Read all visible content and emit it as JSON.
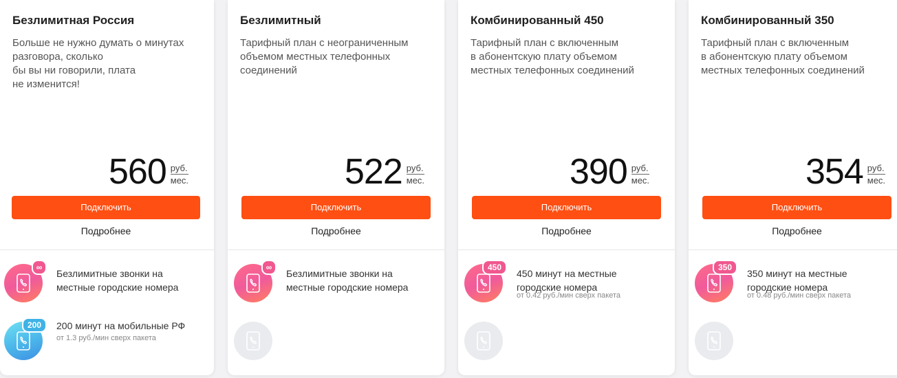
{
  "colors": {
    "accent": "#ff4f12",
    "pink_icon": "#f05a9b",
    "blue_icon": "#4bb6ea",
    "grey_icon": "#e9ebee"
  },
  "cards": [
    {
      "title": "Безлимитная Россия",
      "description": "Больше не нужно думать о минутах\nразговора, сколько\nбы вы ни говорили, плата\nне изменится!",
      "price": "560",
      "unit_top": "руб.",
      "unit_bottom": "мес.",
      "button": "Подключить",
      "more": "Подробнее",
      "features": [
        {
          "icon": "phone-icon",
          "badge": "∞",
          "text": "Безлимитные звонки на\nместные городские номера",
          "sub": ""
        },
        {
          "icon": "phone-icon",
          "badge": "200",
          "text": "200 минут на мобильные РФ",
          "sub": "от 1.3 руб./мин сверх пакета"
        }
      ]
    },
    {
      "title": "Безлимитный",
      "description": "Тарифный план с неограниченным\nобъемом местных телефонных\nсоединений",
      "price": "522",
      "unit_top": "руб.",
      "unit_bottom": "мес.",
      "button": "Подключить",
      "more": "Подробнее",
      "features": [
        {
          "icon": "phone-icon",
          "badge": "∞",
          "text": "Безлимитные звонки на\nместные городские номера",
          "sub": ""
        }
      ]
    },
    {
      "title": "Комбинированный 450",
      "description": "Тарифный план с включенным\nв абонентскую плату объемом\nместных телефонных соединений",
      "price": "390",
      "unit_top": "руб.",
      "unit_bottom": "мес.",
      "button": "Подключить",
      "more": "Подробнее",
      "features": [
        {
          "icon": "phone-icon",
          "badge": "450",
          "text": "450 минут на местные\nгородские номера",
          "sub": "от 0.42 руб./мин сверх пакета"
        }
      ]
    },
    {
      "title": "Комбинированный 350",
      "description": "Тарифный план с включенным\nв абонентскую плату объемом\nместных телефонных соединений",
      "price": "354",
      "unit_top": "руб.",
      "unit_bottom": "мес.",
      "button": "Подключить",
      "more": "Подробнее",
      "features": [
        {
          "icon": "phone-icon",
          "badge": "350",
          "text": "350 минут на местные\nгородские номера",
          "sub": "от 0.48 руб./мин сверх пакета"
        }
      ]
    }
  ]
}
